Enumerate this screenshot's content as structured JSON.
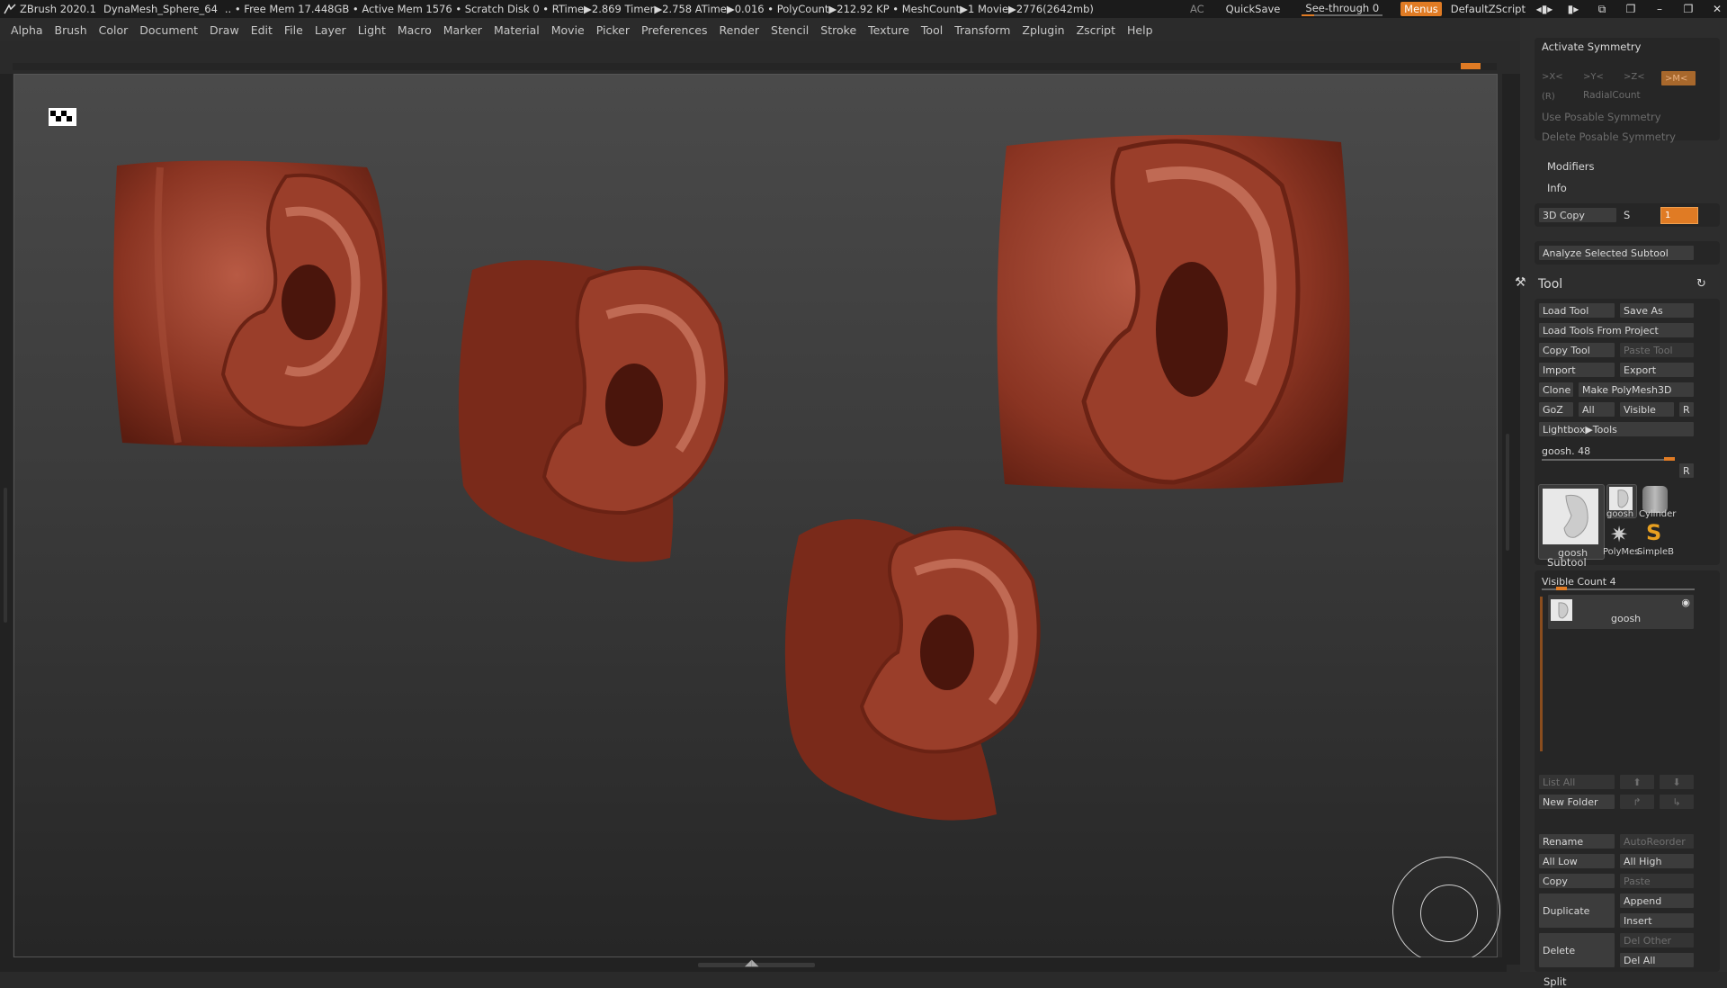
{
  "titlebar": {
    "app": "ZBrush 2020.1",
    "document": "DynaMesh_Sphere_64",
    "stats": ".. • Free Mem 17.448GB • Active Mem 1576 • Scratch Disk 0 •  RTime▶2.869 Timer▶2.758 ATime▶0.016 • PolyCount▶212.92 KP • MeshCount▶1  Movie▶2776(2642mb)",
    "ac": "AC",
    "quicksave": "QuickSave",
    "see_through": "See-through   0",
    "menus": "Menus",
    "script": "DefaultZScript"
  },
  "menubar": [
    "Alpha",
    "Brush",
    "Color",
    "Document",
    "Draw",
    "Edit",
    "File",
    "Layer",
    "Light",
    "Macro",
    "Marker",
    "Material",
    "Movie",
    "Picker",
    "Preferences",
    "Render",
    "Stencil",
    "Stroke",
    "Texture",
    "Tool",
    "Transform",
    "Zplugin",
    "Zscript",
    "Help"
  ],
  "symmetry": {
    "title": "Activate Symmetry",
    "axes": [
      ">X<",
      ">Y<",
      ">Z<",
      ">M<"
    ],
    "r": "(R)",
    "radial": "RadialCount",
    "posable": "Use Posable Symmetry",
    "delete_posable": "Delete Posable Symmetry"
  },
  "modifiers": "Modifiers",
  "info": "Info",
  "copy3d": {
    "label": "3D Copy",
    "s": "S",
    "field": "1"
  },
  "analyze": "Analyze Selected Subtool",
  "tool": {
    "title": "Tool",
    "load": "Load Tool",
    "save_as": "Save As",
    "load_project": "Load Tools From Project",
    "copy": "Copy Tool",
    "paste": "Paste Tool",
    "import": "Import",
    "export": "Export",
    "clone": "Clone",
    "make_polymesh": "Make PolyMesh3D",
    "goz": "GoZ",
    "all": "All",
    "visible": "Visible",
    "r": "R",
    "lightbox": "Lightbox▶Tools",
    "current": "goosh. 48",
    "r2": "R",
    "thumbs": [
      "goosh",
      "goosh",
      "Cylinder",
      "PolyMes",
      "SimpleB"
    ]
  },
  "subtool": {
    "title": "Subtool",
    "visible_count": "Visible Count 4",
    "item": "goosh",
    "list_all": "List All",
    "new_folder": "New Folder",
    "rename": "Rename",
    "autoreorder": "AutoReorder",
    "all_low": "All Low",
    "all_high": "All High",
    "copy": "Copy",
    "paste": "Paste",
    "duplicate": "Duplicate",
    "append": "Append",
    "insert": "Insert",
    "delete": "Delete",
    "del_other": "Del Other",
    "del_all": "Del All",
    "split": "Split"
  },
  "colors": {
    "accent": "#e07b24",
    "clay": "#8a3422"
  }
}
